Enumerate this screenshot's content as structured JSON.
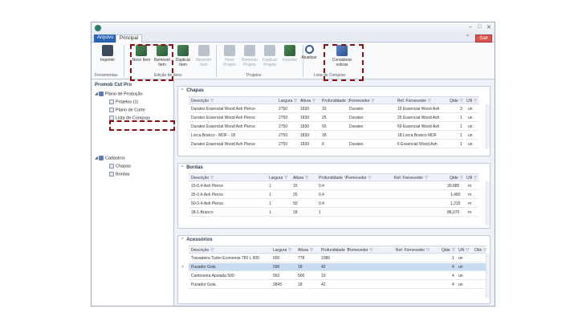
{
  "window": {
    "title_minimize": "–",
    "title_maximize": "□",
    "title_close": "✕"
  },
  "menu": {
    "file": "Arquivo",
    "home": "Principal",
    "exit": "Sair",
    "collapse": "^"
  },
  "ribbon": {
    "buttons": [
      {
        "key": "imprimir",
        "label": "Imprimir",
        "icon": "printer-icon"
      },
      {
        "key": "novo_item",
        "label": "Novo Item",
        "icon": "new-item-icon"
      },
      {
        "key": "remover_item",
        "label": "Remover Item",
        "icon": "remove-item-icon"
      },
      {
        "key": "duplicar_item",
        "label": "Duplicar Item",
        "icon": "duplicate-item-icon"
      },
      {
        "key": "reverter_item",
        "label": "Reverter Item",
        "icon": "revert-item-icon"
      },
      {
        "key": "novo_projeto",
        "label": "Novo Projeto",
        "icon": "new-project-icon"
      },
      {
        "key": "remover_projeto",
        "label": "Remover Projeto",
        "icon": "remove-project-icon"
      },
      {
        "key": "duplicar_projeto",
        "label": "Duplicar Projeto",
        "icon": "duplicate-project-icon"
      },
      {
        "key": "importar",
        "label": "Importar",
        "icon": "import-icon"
      },
      {
        "key": "atualizar",
        "label": "Atualizar",
        "icon": "refresh-icon"
      },
      {
        "key": "considerar",
        "label": "Considerar sobras",
        "icon": "consider-icon"
      }
    ],
    "groups": [
      "Ferramentas",
      "Edição de Itens",
      "Projetos",
      "Lista de Compras"
    ]
  },
  "sidebar": {
    "title": "Promob Cut Pro",
    "tree": [
      {
        "label": "Plano de Produção",
        "level": 0
      },
      {
        "label": "Projetos (1)",
        "level": 1
      },
      {
        "label": "Plano de Corte",
        "level": 1
      },
      {
        "label": "Lista de Compras",
        "level": 1
      },
      {
        "label": "Cadastros",
        "level": 0
      },
      {
        "label": "Chapas",
        "level": 1
      },
      {
        "label": "Bordas",
        "level": 1
      }
    ]
  },
  "chapas": {
    "title": "Chapas",
    "columns": [
      "Descrição",
      "Largura",
      "Altura",
      "Profundidade",
      "Fornecedor",
      "Ref. Fornecedor",
      "Qtde",
      "UN"
    ],
    "rows": [
      [
        "Duratex Essencial Wood Ash Pierce",
        "2750",
        "1830",
        "15",
        "Duratex",
        "15 Essencial Wood Ash",
        "3",
        "un"
      ],
      [
        "Duratex Essencial Wood Ash Pierce",
        "2750",
        "1830",
        "25",
        "Duratex",
        "25 Essencial Wood Ash",
        "1",
        "un"
      ],
      [
        "Duratex Essencial Wood Ash Pierce",
        "2750",
        "1830",
        "50",
        "Duratex",
        "50 Essencial Wood Ash",
        "1",
        "un"
      ],
      [
        "Lorca Branco - MDF - 18",
        "2750",
        "1830",
        "18",
        "",
        "18 Lorca Branco MDF",
        "1",
        "un"
      ],
      [
        "Duratex Essencial Wood Ash Pierce",
        "2750",
        "1830",
        "6",
        "Duratex",
        "6 Essencial Wood Ash",
        "1",
        "un"
      ]
    ]
  },
  "bordas": {
    "title": "Bordas",
    "columns": [
      "Descrição",
      "Largura",
      "Altura",
      "Profundidade",
      "Fornecedor",
      "Ref. Fornecedor",
      "Qtde",
      "UN"
    ],
    "rows": [
      [
        "15-0.4-Ash Pierce",
        "1",
        "15",
        "0.4",
        "",
        "",
        "30,885",
        "m"
      ],
      [
        "25-0.4-Ash Pierce",
        "1",
        "25",
        "0.4",
        "",
        "",
        "1,480",
        "m"
      ],
      [
        "50-0.4-Ash Pierce",
        "1",
        "50",
        "0.4",
        "",
        "",
        "1,215",
        "m"
      ],
      [
        "18-1-Branco",
        "1",
        "18",
        "1",
        "",
        "",
        "88,070",
        "m"
      ]
    ]
  },
  "acessorios": {
    "title": "Acessórios",
    "columns": [
      "Descrição",
      "Largura",
      "Altura",
      "Profundidade",
      "Fornecedor",
      "Ref. Fornecedor",
      "Qtde",
      "UN",
      "Obs"
    ],
    "rows": [
      [
        "Travadeira Turbo Economia 780 L 600",
        "600",
        "778",
        "1086",
        "",
        "",
        "1",
        "un",
        ""
      ],
      [
        "Puxador Gola",
        "590",
        "18",
        "42",
        "",
        "",
        "4",
        "un",
        ""
      ],
      [
        "Cantoneira Apoiada 500",
        "563",
        "500",
        "19",
        "",
        "",
        "4",
        "un",
        ""
      ],
      [
        "Puxador Gola",
        "2845",
        "18",
        "42",
        "",
        "",
        "4",
        "un",
        ""
      ]
    ],
    "selected_row": 1,
    "selected_marker": ">"
  }
}
